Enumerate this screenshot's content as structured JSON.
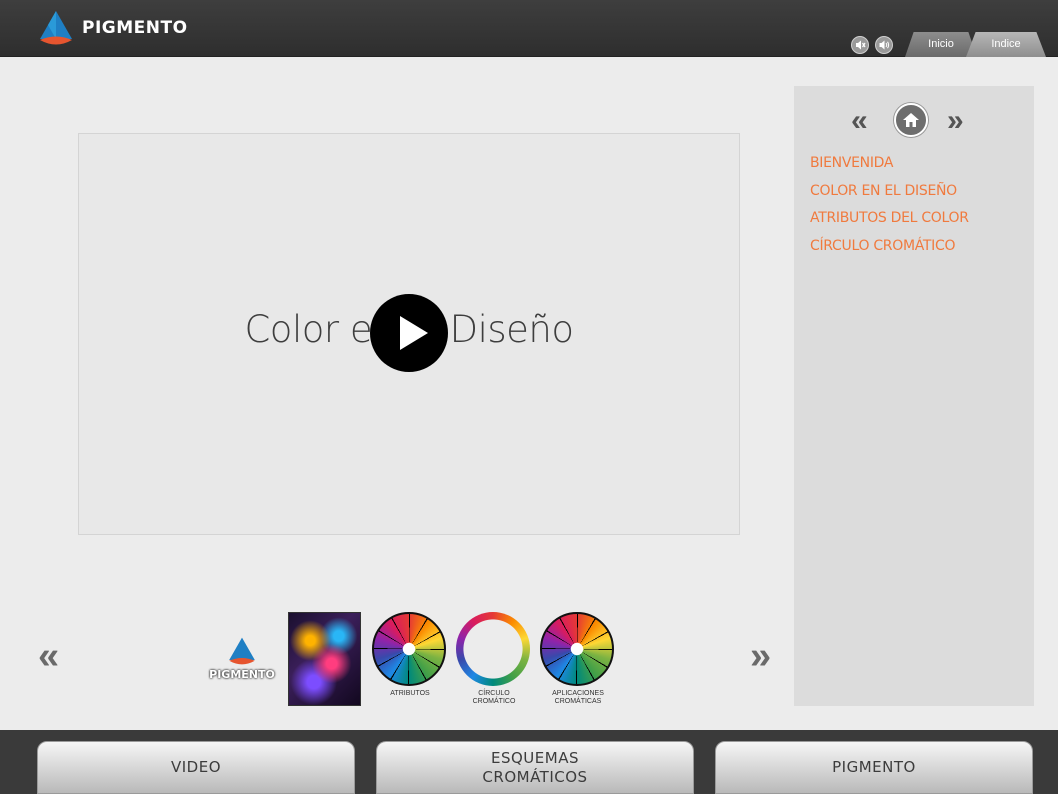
{
  "header": {
    "brand": "PIGMENTO",
    "tabs": [
      {
        "label": "Inicio"
      },
      {
        "label": "Indice"
      }
    ]
  },
  "video": {
    "title": "Color en el Diseño"
  },
  "panel": {
    "menu": [
      {
        "label": "BIENVENIDA"
      },
      {
        "label": "COLOR EN EL DISEÑO"
      },
      {
        "label": "ATRIBUTOS DEL COLOR"
      },
      {
        "label": "CÍRCULO CROMÁTICO"
      }
    ]
  },
  "carousel": {
    "prev_symbol": "«",
    "next_symbol": "»",
    "thumbs": [
      {
        "name": "pigmento-logo",
        "caption": "PIGMENTO"
      },
      {
        "name": "poster",
        "caption": ""
      },
      {
        "name": "atributos",
        "caption": "ATRIBUTOS"
      },
      {
        "name": "circulo-cromatico",
        "caption": "CÍRCULO CROMÁTICO"
      },
      {
        "name": "aplicaciones-cromaticas",
        "caption": "APLICACIONES CROMÁTICAS"
      }
    ]
  },
  "bottom_bar": {
    "buttons": [
      {
        "label": "VIDEO"
      },
      {
        "label": "ESQUEMAS CROMÁTICOS"
      },
      {
        "label": "PIGMENTO"
      }
    ]
  },
  "colors": {
    "accent_orange": "#f07a3e",
    "logo_blue": "#1f7fc4",
    "logo_red": "#d9472b"
  },
  "icons": {
    "sound_off": "speaker-mute-icon",
    "sound_on": "speaker-on-icon",
    "home": "home-icon",
    "play": "play-icon"
  }
}
